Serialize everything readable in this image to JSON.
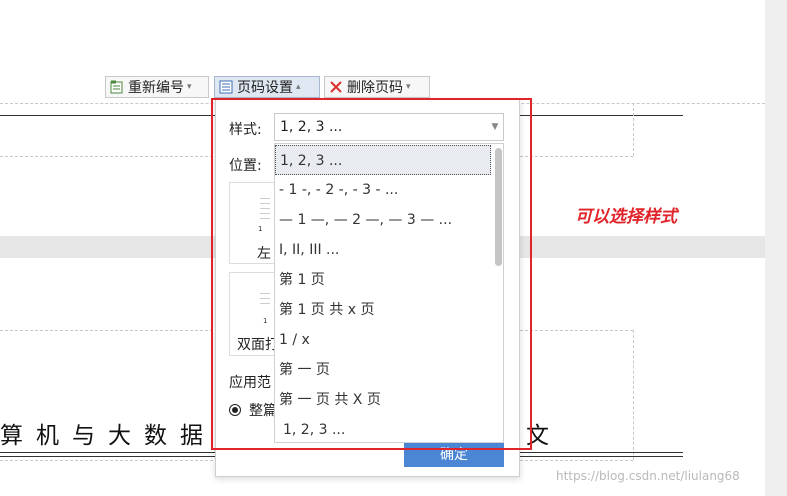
{
  "toolbar": {
    "renumber_label": "重新编号",
    "page_setup_label": "页码设置",
    "delete_label": "删除页码"
  },
  "dialog": {
    "style_label": "样式:",
    "style_value": "1, 2, 3 ...",
    "position_label": "位置:",
    "position_left_label": "左",
    "duplex_label": "双面打",
    "apply_label": "应用范",
    "apply_whole_label": "整篇",
    "ok_label": "确定",
    "style_options": [
      "1, 2, 3 ...",
      "- 1 -, - 2 -, - 3 - ...",
      "— 1 —, — 2 —, — 3 — ...",
      "I, II, III ...",
      "第 1 页",
      "第 1 页 共 x 页",
      "1 / x",
      "第 一 页",
      "第 一 页 共 X 页",
      "1, 2, 3 ..."
    ]
  },
  "document": {
    "text_left": "算机与大数据",
    "text_right": "论文"
  },
  "annotation": "可以选择样式",
  "watermark": "https://blog.csdn.net/liulang68",
  "colors": {
    "accent": "#4a86d4",
    "annotation": "#e0242a"
  }
}
